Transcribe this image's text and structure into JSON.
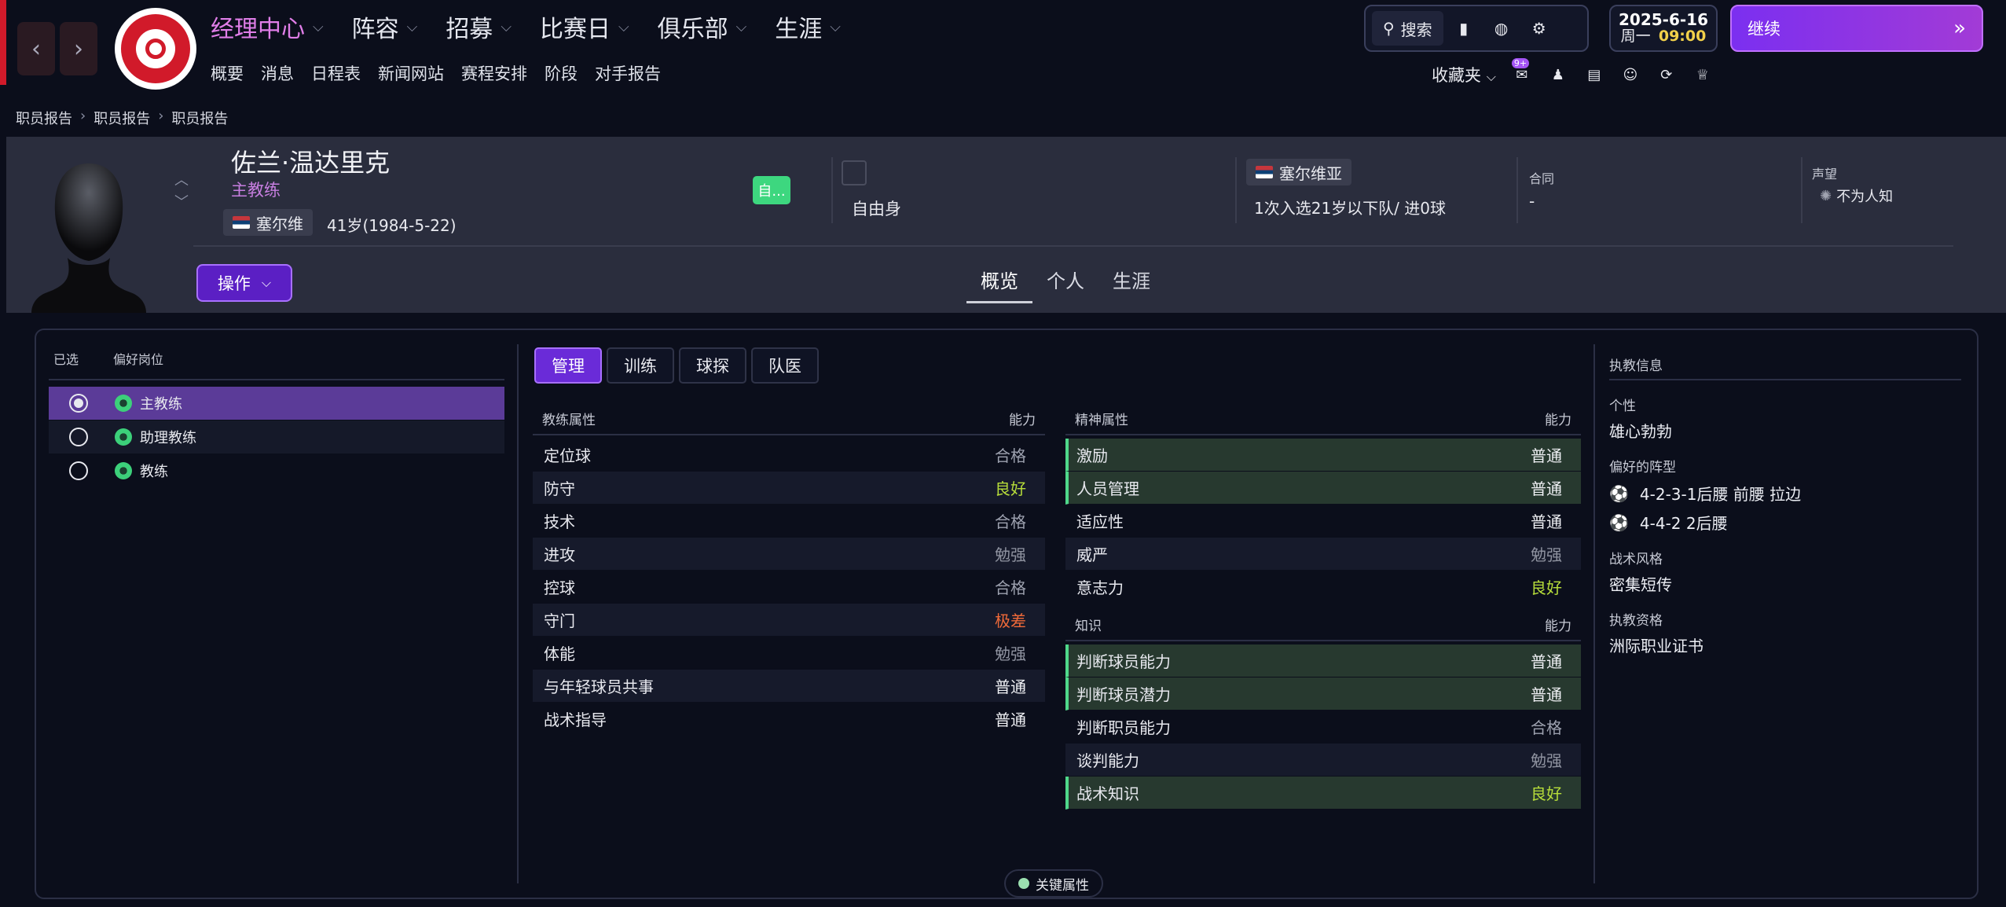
{
  "nav": {
    "main": [
      {
        "label": "经理中心"
      },
      {
        "label": "阵容"
      },
      {
        "label": "招募"
      },
      {
        "label": "比赛日"
      },
      {
        "label": "俱乐部"
      },
      {
        "label": "生涯"
      }
    ],
    "sub": [
      "概要",
      "消息",
      "日程表",
      "新闻网站",
      "赛程安排",
      "阶段",
      "对手报告"
    ]
  },
  "toolbar": {
    "search_label": "搜索"
  },
  "date": {
    "date": "2025-6-16",
    "weekday": "周一",
    "time": "09:00"
  },
  "continue_label": "继续",
  "favorites": {
    "label": "收藏夹",
    "badge": "9+"
  },
  "breadcrumb": [
    "职员报告",
    "职员报告",
    "职员报告"
  ],
  "staff": {
    "name": "佐兰·温达里克",
    "role": "主教练",
    "nationality": "塞尔维",
    "age": "41岁(1984-5-22)",
    "status_badge": "自...",
    "contract_status": "自由身",
    "national_team": "塞尔维亚",
    "caps": "1次入选21岁以下队/ 进0球",
    "contract_label": "合同",
    "contract_value": "-",
    "reputation_label": "声望",
    "reputation_value": "不为人知"
  },
  "action_label": "操作",
  "profile_tabs": [
    "概览",
    "个人",
    "生涯"
  ],
  "roles": {
    "header_selected": "已选",
    "header_pos": "偏好岗位",
    "items": [
      "主教练",
      "助理教练",
      "教练"
    ]
  },
  "attr_tabs": [
    "管理",
    "训练",
    "球探",
    "队医"
  ],
  "coaching": {
    "header": "教练属性",
    "ability": "能力",
    "rows": [
      {
        "name": "定位球",
        "value": "合格"
      },
      {
        "name": "防守",
        "value": "良好"
      },
      {
        "name": "技术",
        "value": "合格"
      },
      {
        "name": "进攻",
        "value": "勉强"
      },
      {
        "name": "控球",
        "value": "合格"
      },
      {
        "name": "守门",
        "value": "极差"
      },
      {
        "name": "体能",
        "value": "勉强"
      },
      {
        "name": "与年轻球员共事",
        "value": "普通"
      },
      {
        "name": "战术指导",
        "value": "普通"
      }
    ]
  },
  "mental": {
    "header": "精神属性",
    "ability": "能力",
    "rows": [
      {
        "name": "激励",
        "value": "普通"
      },
      {
        "name": "人员管理",
        "value": "普通"
      },
      {
        "name": "适应性",
        "value": "普通"
      },
      {
        "name": "威严",
        "value": "勉强"
      },
      {
        "name": "意志力",
        "value": "良好"
      }
    ]
  },
  "knowledge": {
    "header": "知识",
    "ability": "能力",
    "rows": [
      {
        "name": "判断球员能力",
        "value": "普通"
      },
      {
        "name": "判断球员潜力",
        "value": "普通"
      },
      {
        "name": "判断职员能力",
        "value": "合格"
      },
      {
        "name": "谈判能力",
        "value": "勉强"
      },
      {
        "name": "战术知识",
        "value": "良好"
      }
    ]
  },
  "info": {
    "header": "执教信息",
    "personality_label": "个性",
    "personality": "雄心勃勃",
    "formation_label": "偏好的阵型",
    "formations": [
      "4-2-3-1后腰 前腰 拉边",
      "4-4-2 2后腰"
    ],
    "style_label": "战术风格",
    "style": "密集短传",
    "license_label": "执教资格",
    "license": "洲际职业证书"
  },
  "key_attr_label": "关键属性",
  "colors": {
    "accent": "#7b2ff0",
    "key_green": "#4fd88b",
    "good": "#b7dd3a",
    "bad": "#f06a39"
  }
}
